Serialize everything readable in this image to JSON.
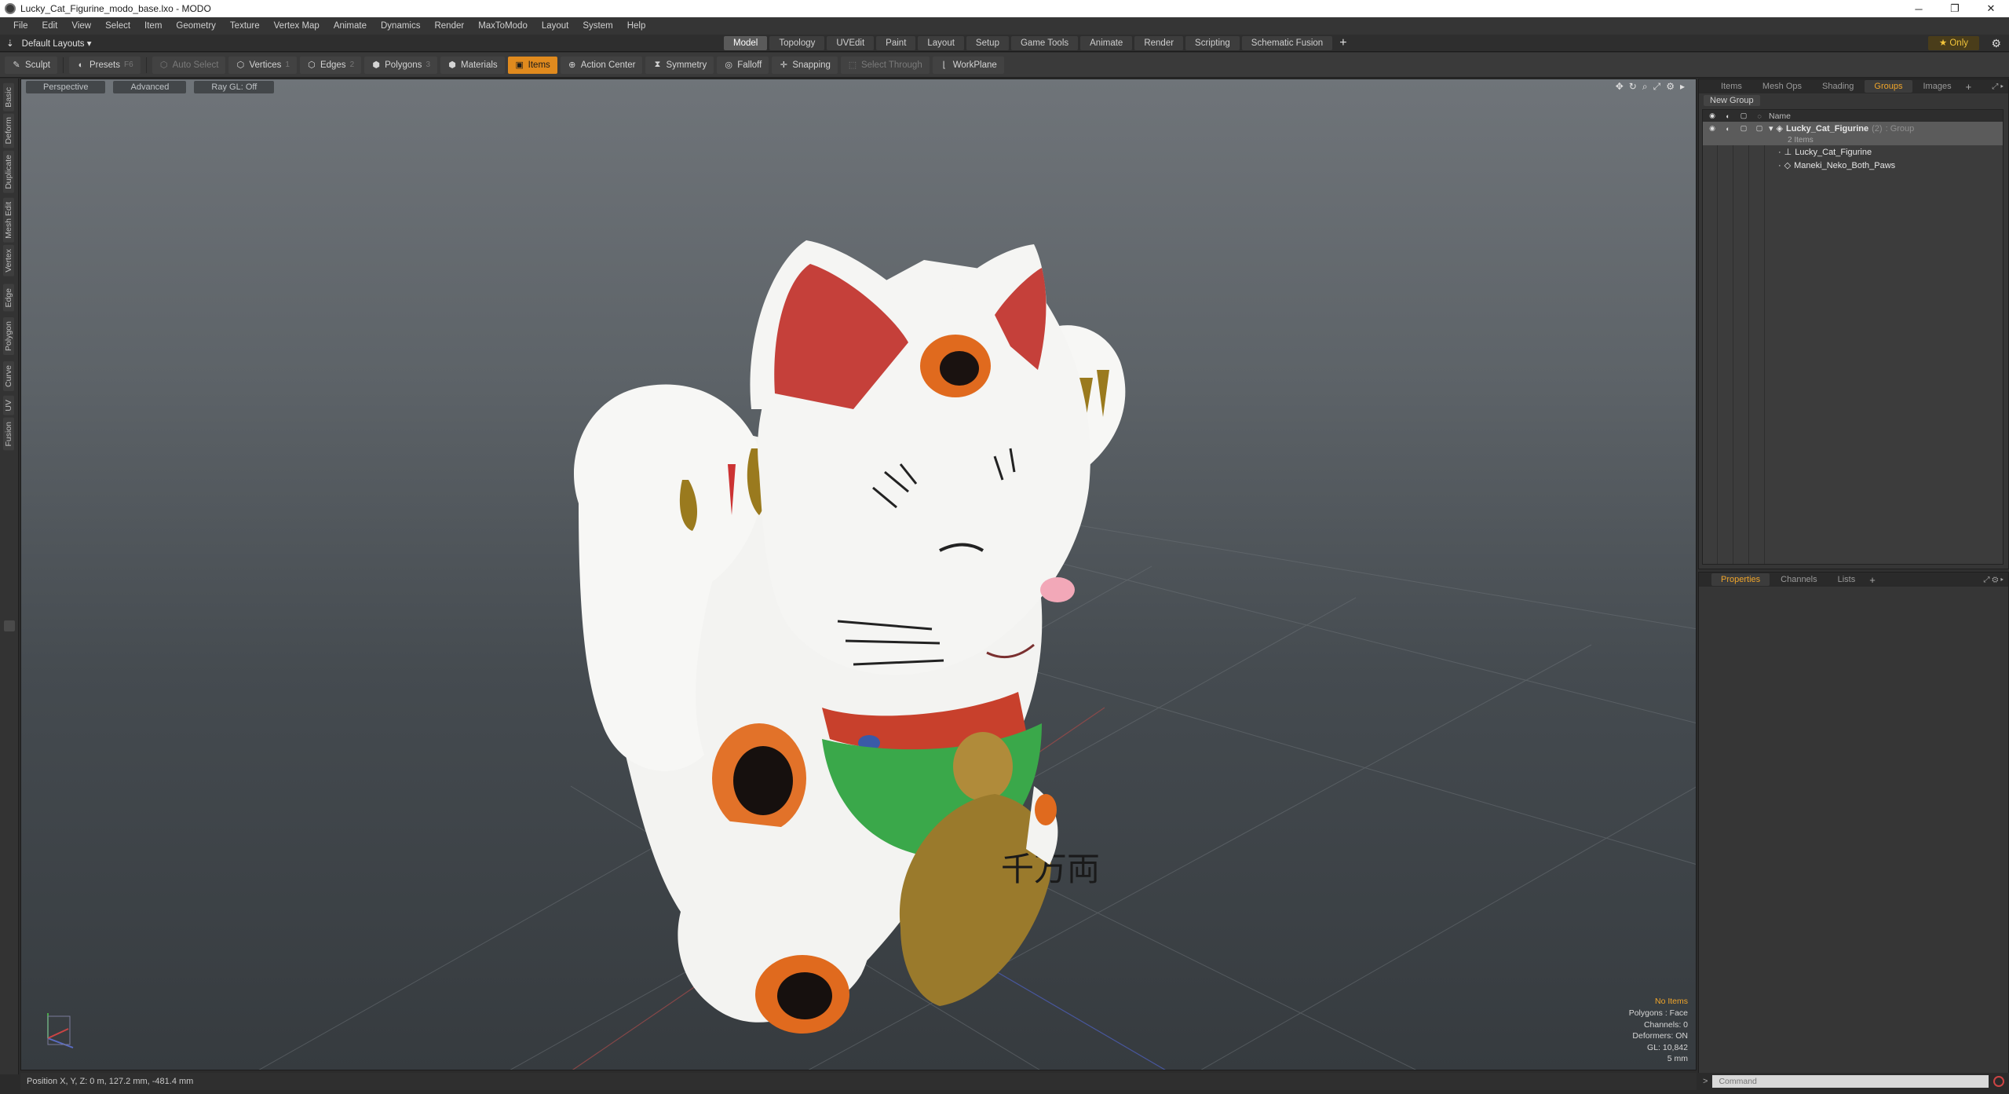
{
  "window": {
    "title": "Lucky_Cat_Figurine_modo_base.lxo - MODO",
    "controls": [
      "─",
      "❐",
      "✕"
    ]
  },
  "menu": [
    "File",
    "Edit",
    "View",
    "Select",
    "Item",
    "Geometry",
    "Texture",
    "Vertex Map",
    "Animate",
    "Dynamics",
    "Render",
    "MaxToModo",
    "Layout",
    "System",
    "Help"
  ],
  "layoutbar": {
    "layout_label": "Default Layouts ▾",
    "tabs": [
      "Model",
      "Topology",
      "UVEdit",
      "Paint",
      "Layout",
      "Setup",
      "Game Tools",
      "Animate",
      "Render",
      "Scripting",
      "Schematic Fusion"
    ],
    "active_tab": "Model",
    "add_label": "+",
    "only_label": "★  Only"
  },
  "toolbar": {
    "sculpt": "Sculpt",
    "presets": "Presets",
    "presets_key": "F6",
    "auto_select": "Auto Select",
    "vertices": "Vertices",
    "vertices_key": "1",
    "edges": "Edges",
    "edges_key": "2",
    "polygons": "Polygons",
    "polygons_key": "3",
    "materials": "Materials",
    "items": "Items",
    "action_center": "Action Center",
    "symmetry": "Symmetry",
    "falloff": "Falloff",
    "snapping": "Snapping",
    "select_through": "Select Through",
    "workplane": "WorkPlane"
  },
  "left_tabs": [
    "Basic",
    "Deform",
    "Duplicate",
    "Mesh Edit",
    "Vertex",
    "Edge",
    "Polygon",
    "Curve",
    "UV",
    "Fusion"
  ],
  "viewport": {
    "view_mode": "Perspective",
    "shading": "Advanced",
    "raygl": "Ray GL: Off",
    "info": {
      "no_items": "No Items",
      "polygons": "Polygons : Face",
      "channels": "Channels: 0",
      "deformers": "Deformers: ON",
      "gl": "GL: 10,842",
      "scale": "5 mm"
    },
    "model_glyphs": "千万両"
  },
  "statusbar": {
    "position": "Position X, Y, Z:   0 m, 127.2 mm, -481.4 mm"
  },
  "groups_panel": {
    "tabs": [
      "Items",
      "Mesh Ops",
      "Shading",
      "Groups",
      "Images"
    ],
    "active_tab": "Groups",
    "new_group": "New Group",
    "column_name": "Name",
    "group": {
      "name": "Lucky_Cat_Figurine",
      "count": "(2)",
      "type": ": Group",
      "subtitle": "2 Items"
    },
    "children": [
      {
        "name": "Lucky_Cat_Figurine",
        "icon": "locator-icon"
      },
      {
        "name": "Maneki_Neko_Both_Paws",
        "icon": "mesh-icon"
      }
    ]
  },
  "props_panel": {
    "tabs": [
      "Properties",
      "Channels",
      "Lists"
    ],
    "active_tab": "Properties"
  },
  "command": {
    "prompt": ">",
    "placeholder": "Command"
  },
  "colors": {
    "accent": "#e08a1e",
    "active_tab_text": "#f0a52a"
  }
}
